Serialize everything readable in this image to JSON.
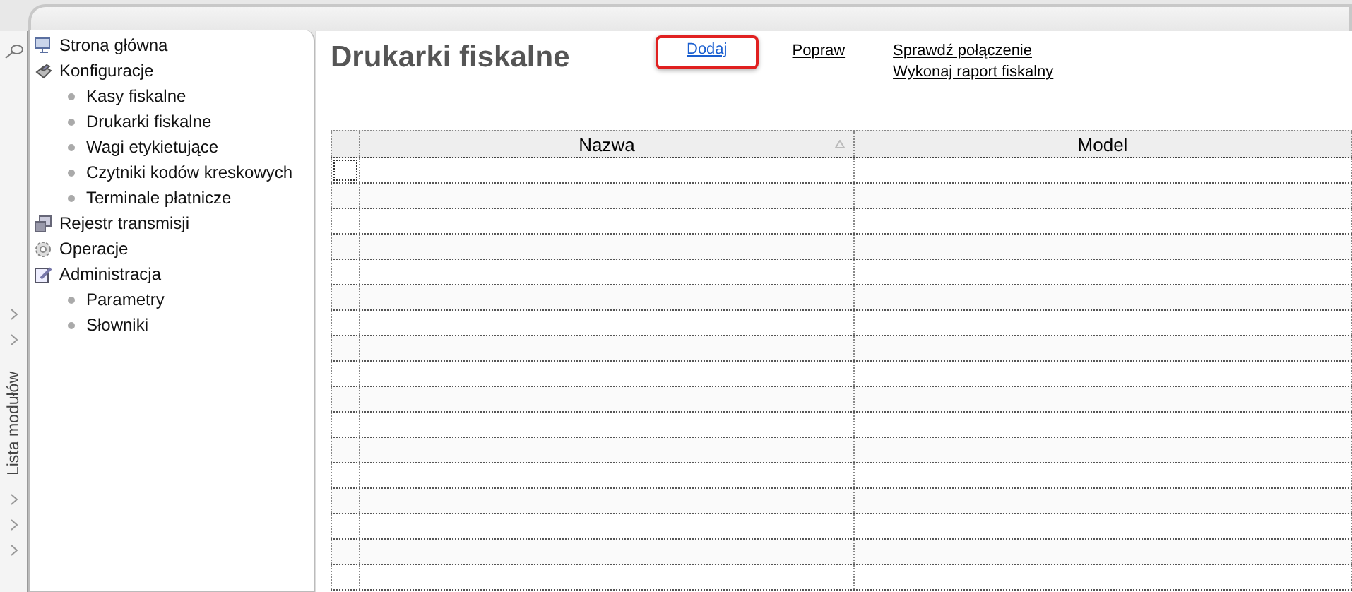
{
  "sidebar": {
    "items": [
      {
        "label": "Strona główna",
        "kind": "home"
      },
      {
        "label": "Konfiguracje",
        "kind": "config",
        "children": [
          {
            "label": "Kasy fiskalne"
          },
          {
            "label": "Drukarki fiskalne"
          },
          {
            "label": "Wagi etykietujące"
          },
          {
            "label": "Czytniki kodów kreskowych"
          },
          {
            "label": "Terminale płatnicze"
          }
        ]
      },
      {
        "label": "Rejestr transmisji",
        "kind": "transfer"
      },
      {
        "label": "Operacje",
        "kind": "gear"
      },
      {
        "label": "Administracja",
        "kind": "edit",
        "children": [
          {
            "label": "Parametry"
          },
          {
            "label": "Słowniki"
          }
        ]
      }
    ]
  },
  "module_strip": {
    "label": "Lista modułów"
  },
  "page": {
    "title": "Drukarki fiskalne"
  },
  "actions": [
    {
      "label": "Dodaj",
      "highlighted": true
    },
    {
      "label": "Popraw",
      "highlighted": false
    },
    {
      "label": "Sprawdź połączenie",
      "highlighted": false
    },
    {
      "label": "Wykonaj raport fiskalny",
      "highlighted": false
    }
  ],
  "table": {
    "columns": [
      {
        "label": "Nazwa",
        "sorted": true
      },
      {
        "label": "Model",
        "sorted": false
      }
    ]
  }
}
